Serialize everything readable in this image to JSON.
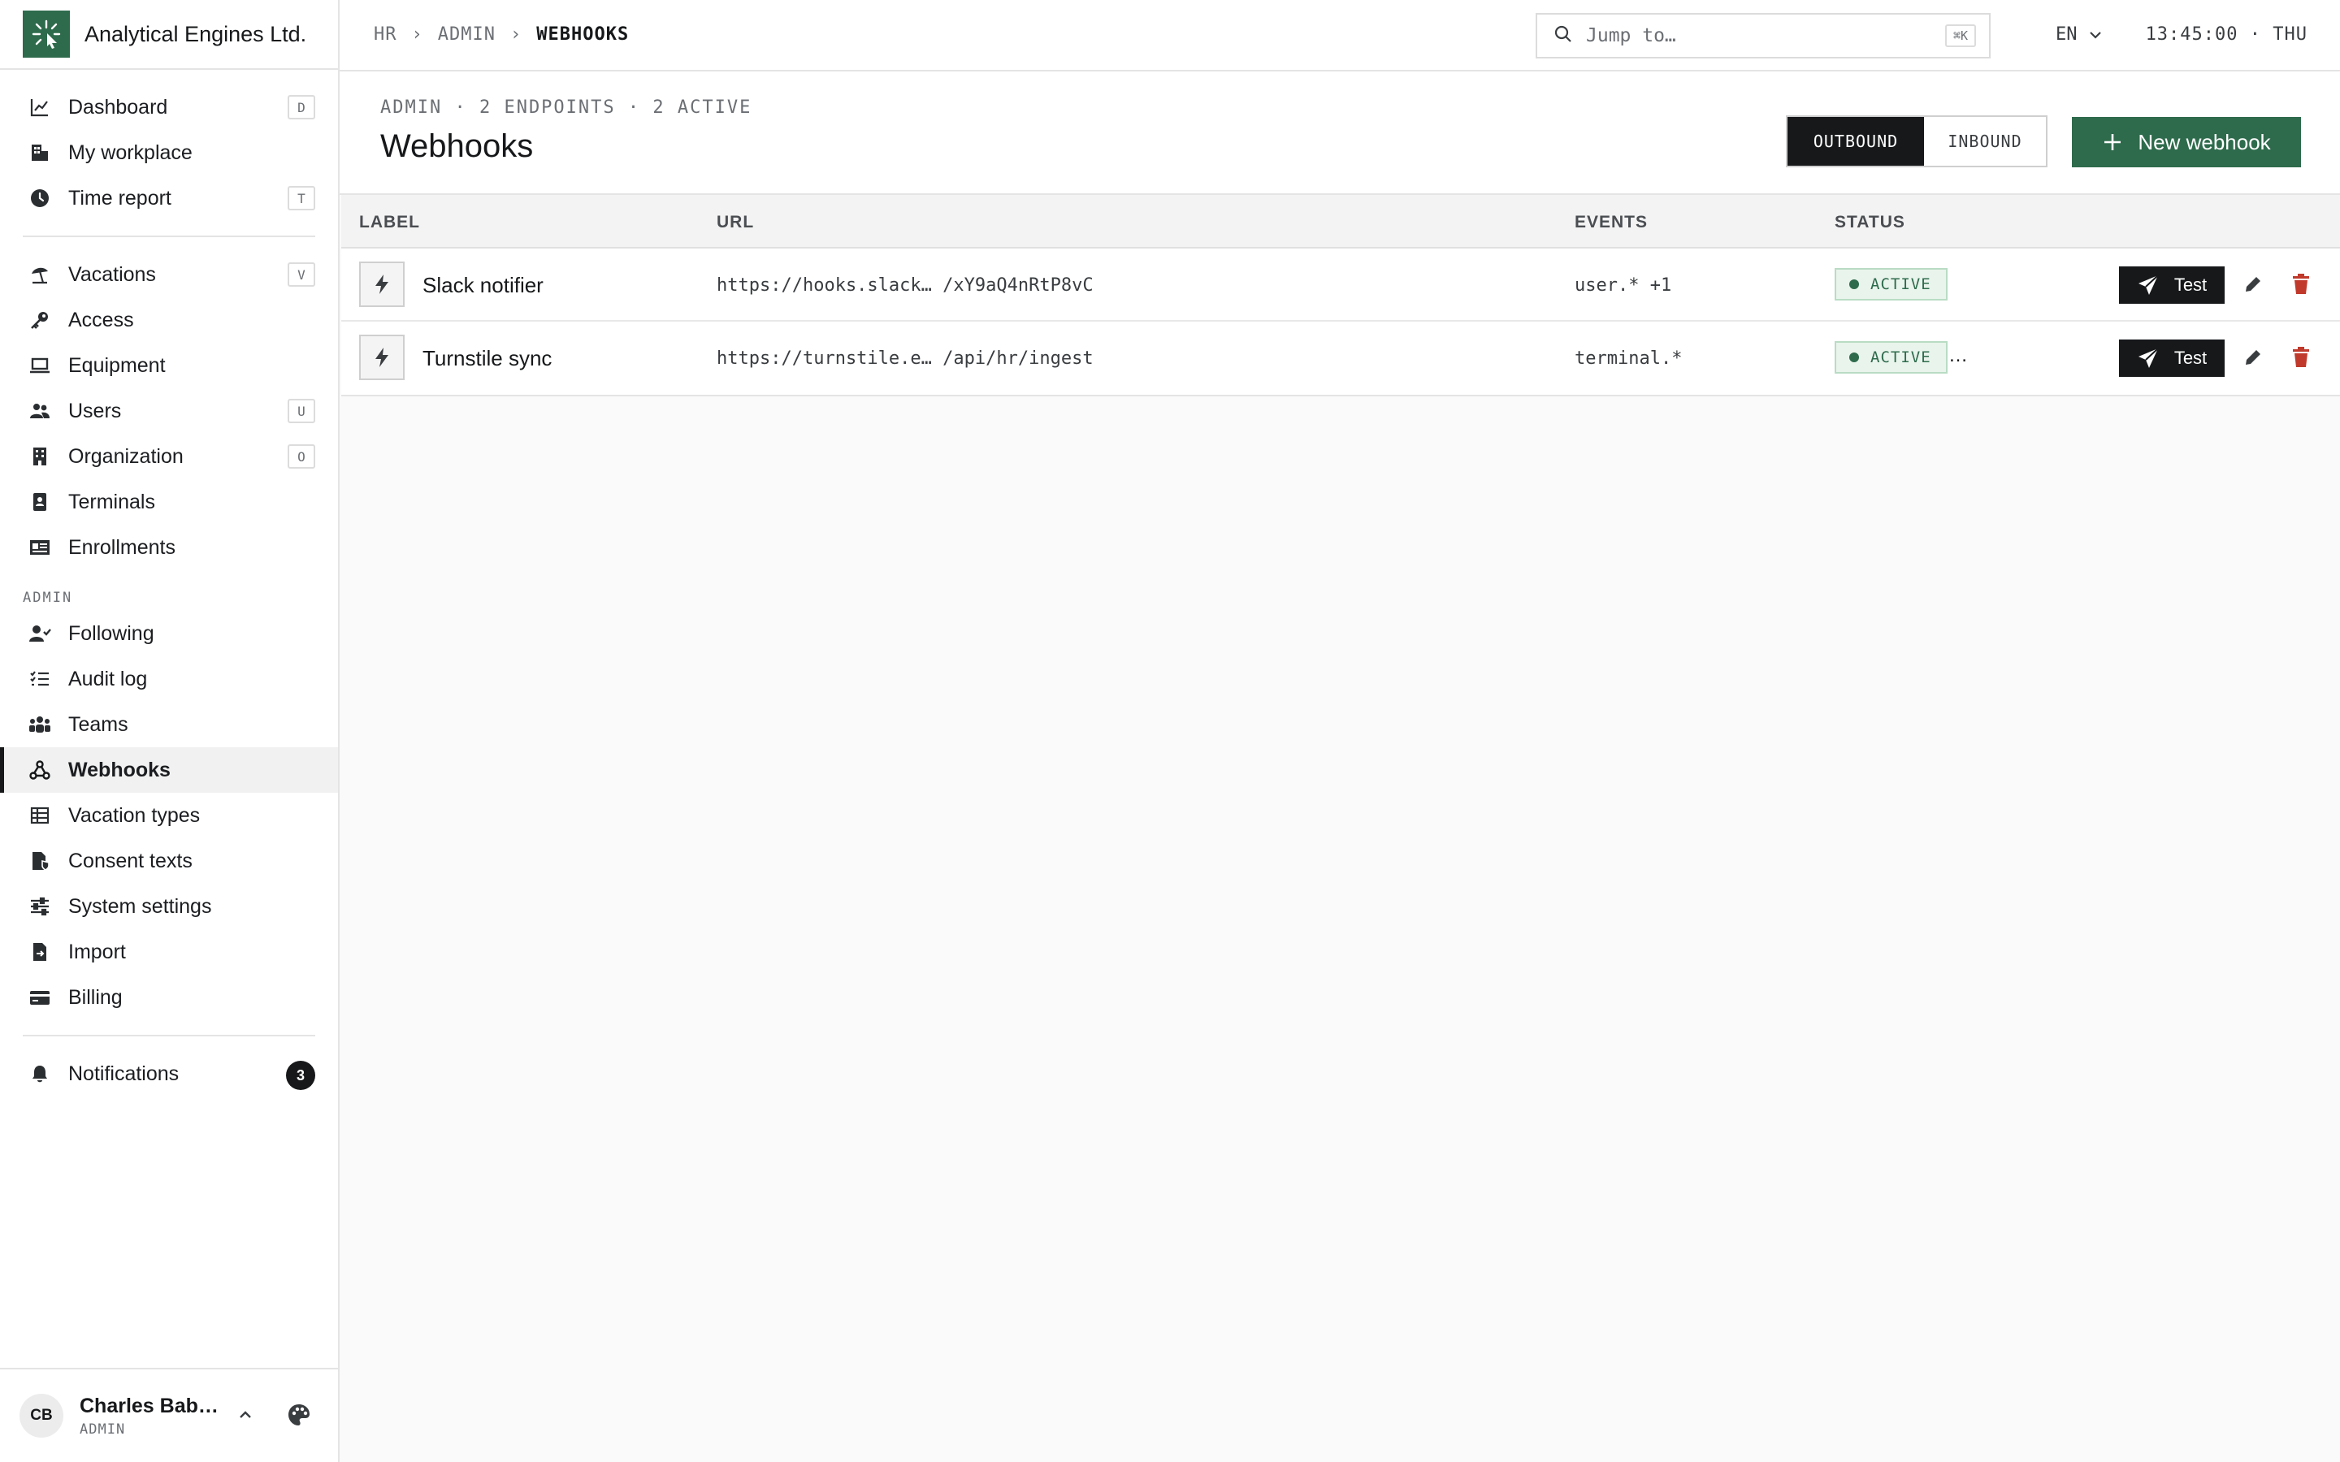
{
  "brand": {
    "name": "Analytical Engines Ltd."
  },
  "nav": {
    "items": [
      {
        "label": "Dashboard",
        "icon": "chart-line-icon",
        "kbd": "D"
      },
      {
        "label": "My workplace",
        "icon": "building-icon",
        "kbd": ""
      },
      {
        "label": "Time report",
        "icon": "clock-icon",
        "kbd": "T"
      }
    ],
    "items2": [
      {
        "label": "Vacations",
        "icon": "beach-umbrella-icon",
        "kbd": "V"
      },
      {
        "label": "Access",
        "icon": "key-icon",
        "kbd": ""
      },
      {
        "label": "Equipment",
        "icon": "laptop-icon",
        "kbd": ""
      },
      {
        "label": "Users",
        "icon": "users-icon",
        "kbd": "U"
      },
      {
        "label": "Organization",
        "icon": "office-building-icon",
        "kbd": "O"
      },
      {
        "label": "Terminals",
        "icon": "terminal-device-icon",
        "kbd": ""
      },
      {
        "label": "Enrollments",
        "icon": "id-card-icon",
        "kbd": ""
      }
    ],
    "admin_label": "ADMIN",
    "admin_items": [
      {
        "label": "Following",
        "icon": "user-check-icon"
      },
      {
        "label": "Audit log",
        "icon": "list-check-icon"
      },
      {
        "label": "Teams",
        "icon": "team-icon"
      },
      {
        "label": "Webhooks",
        "icon": "webhook-icon",
        "active": true
      },
      {
        "label": "Vacation types",
        "icon": "table-icon"
      },
      {
        "label": "Consent texts",
        "icon": "document-shield-icon"
      },
      {
        "label": "System settings",
        "icon": "sliders-icon"
      },
      {
        "label": "Import",
        "icon": "file-import-icon"
      },
      {
        "label": "Billing",
        "icon": "credit-card-icon"
      }
    ],
    "notifications": {
      "label": "Notifications",
      "icon": "bell-icon",
      "count": "3"
    }
  },
  "user": {
    "initials": "CB",
    "name": "Charles Bab…",
    "role": "ADMIN"
  },
  "topbar": {
    "breadcrumb": [
      "HR",
      "ADMIN",
      "WEBHOOKS"
    ],
    "search": {
      "placeholder": "Jump to…",
      "shortcut": "⌘K"
    },
    "language": "EN",
    "clock": "13:45:00 · THU"
  },
  "page": {
    "subtitle": "ADMIN · 2 ENDPOINTS · 2 ACTIVE",
    "title": "Webhooks",
    "tabs": [
      "OUTBOUND",
      "INBOUND"
    ],
    "active_tab": "OUTBOUND",
    "new_button": "New webhook"
  },
  "table": {
    "columns": [
      "LABEL",
      "URL",
      "EVENTS",
      "STATUS"
    ],
    "rows": [
      {
        "label": "Slack notifier",
        "url": "https://hooks.slack… /xY9aQ4nRtP8vC",
        "events": "user.* +1",
        "status": "ACTIVE",
        "overflow": ""
      },
      {
        "label": "Turnstile sync",
        "url": "https://turnstile.e… /api/hr/ingest",
        "events": "terminal.*",
        "status": "ACTIVE",
        "overflow": "…"
      }
    ],
    "test_label": "Test"
  },
  "colors": {
    "accent": "#2e6b4c",
    "dark": "#16181a",
    "danger": "#c0392b"
  }
}
